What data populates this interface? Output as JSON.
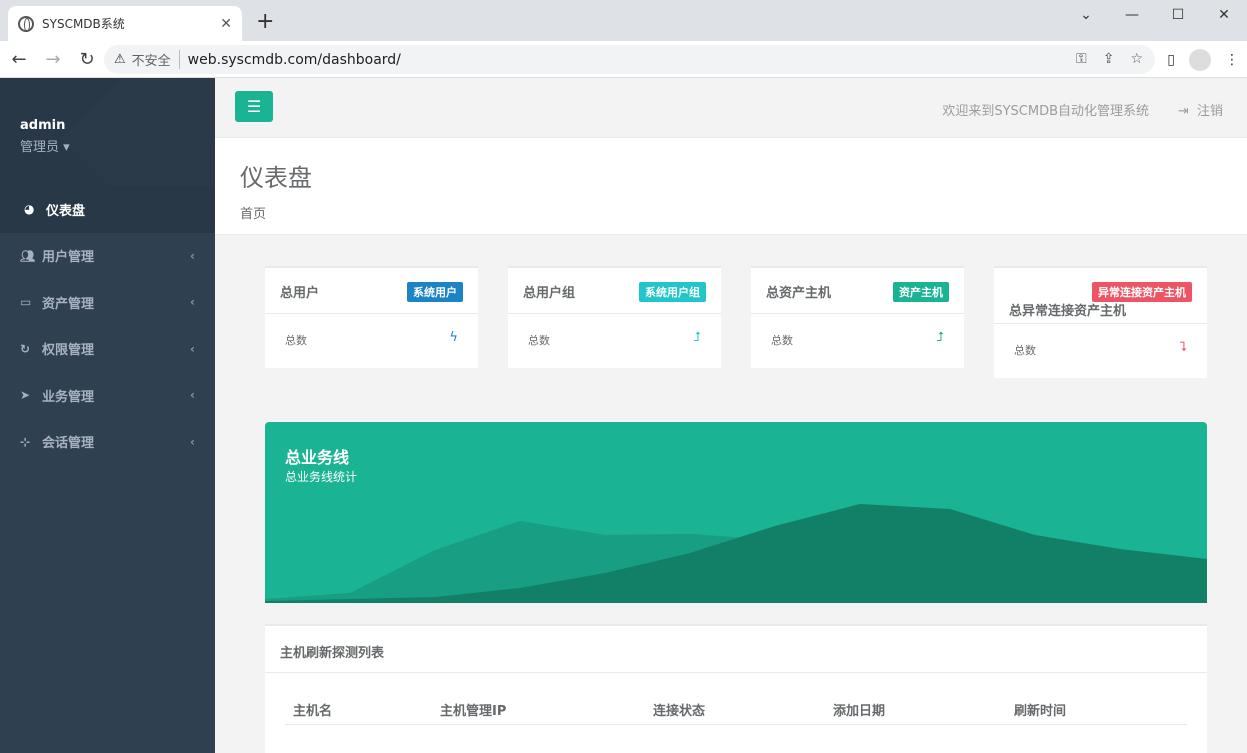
{
  "browser": {
    "tab_title": "SYSCMDB系统",
    "insecure_label": "不安全",
    "url": "web.syscmdb.com/dashboard/"
  },
  "sidebar": {
    "user_name": "admin",
    "user_role": "管理员",
    "items": [
      {
        "label": "仪表盘",
        "icon": "dashboard-icon"
      },
      {
        "label": "用户管理",
        "icon": "users-icon"
      },
      {
        "label": "资产管理",
        "icon": "desktop-icon"
      },
      {
        "label": "权限管理",
        "icon": "refresh-icon"
      },
      {
        "label": "业务管理",
        "icon": "paper-plane-icon"
      },
      {
        "label": "会话管理",
        "icon": "sitemap-icon"
      }
    ]
  },
  "topbar": {
    "welcome": "欢迎来到SYSCMDB自动化管理系统",
    "logout": "注销"
  },
  "heading": {
    "title": "仪表盘",
    "breadcrumb": "首页"
  },
  "widgets": [
    {
      "title": "总用户",
      "badge": "系统用户",
      "badge_color": "#1c84c6",
      "label": "总数",
      "icon": "bolt-icon",
      "icon_color": "#1c84c6"
    },
    {
      "title": "总用户组",
      "badge": "系统用户组",
      "badge_color": "#23c6c8",
      "label": "总数",
      "icon": "level-up-icon",
      "icon_color": "#23c6c8"
    },
    {
      "title": "总资产主机",
      "badge": "资产主机",
      "badge_color": "#1ab394",
      "label": "总数",
      "icon": "level-up-icon",
      "icon_color": "#1ab394"
    },
    {
      "title": "总异常连接资产主机",
      "badge": "异常连接资产主机",
      "badge_color": "#ed5565",
      "label": "总数",
      "icon": "level-down-icon",
      "icon_color": "#ed5565"
    }
  ],
  "banner": {
    "title": "总业务线",
    "subtitle": "总业务线统计",
    "color": "#1ab394"
  },
  "host_table": {
    "title": "主机刷新探测列表",
    "columns": [
      "主机名",
      "主机管理IP",
      "连接状态",
      "添加日期",
      "刷新时间"
    ]
  }
}
